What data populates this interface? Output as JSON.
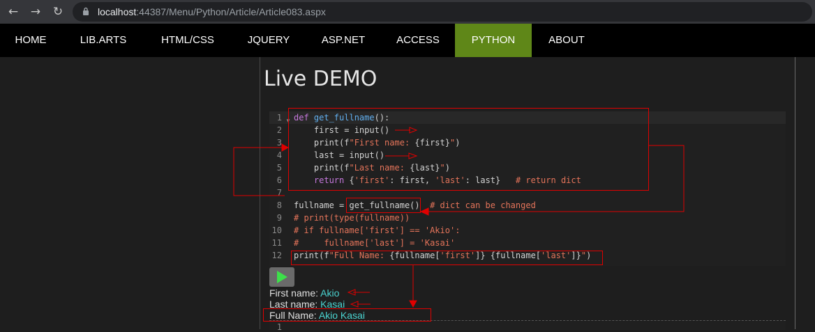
{
  "browser": {
    "url_host": "localhost",
    "url_rest": ":44387/Menu/Python/Article/Article083.aspx"
  },
  "nav": {
    "items": [
      {
        "label": "HOME",
        "active": false
      },
      {
        "label": "LIB.ARTS",
        "active": false
      },
      {
        "label": "HTML/CSS",
        "active": false
      },
      {
        "label": "JQUERY",
        "active": false
      },
      {
        "label": "ASP.NET",
        "active": false
      },
      {
        "label": "ACCESS",
        "active": false
      },
      {
        "label": "PYTHON",
        "active": true
      },
      {
        "label": "ABOUT",
        "active": false
      }
    ],
    "active_color": "#5f8718"
  },
  "page": {
    "title": "Live DEMO"
  },
  "editor": {
    "line_numbers": [
      "1",
      "2",
      "3",
      "4",
      "5",
      "6",
      "7",
      "8",
      "9",
      "10",
      "11",
      "12"
    ],
    "lines": [
      [
        {
          "t": "def ",
          "c": "kw"
        },
        {
          "t": "get_fullname",
          "c": "fn"
        },
        {
          "t": "():",
          "c": ""
        }
      ],
      [
        {
          "t": "    first = input()",
          "c": ""
        }
      ],
      [
        {
          "t": "    print(f",
          "c": ""
        },
        {
          "t": "\"First name: ",
          "c": "str"
        },
        {
          "t": "{first}",
          "c": ""
        },
        {
          "t": "\"",
          "c": "str"
        },
        {
          "t": ")",
          "c": ""
        }
      ],
      [
        {
          "t": "    last = input()",
          "c": ""
        }
      ],
      [
        {
          "t": "    print(f",
          "c": ""
        },
        {
          "t": "\"Last name: ",
          "c": "str"
        },
        {
          "t": "{last}",
          "c": ""
        },
        {
          "t": "\"",
          "c": "str"
        },
        {
          "t": ")",
          "c": ""
        }
      ],
      [
        {
          "t": "    ",
          "c": ""
        },
        {
          "t": "return",
          "c": "kw"
        },
        {
          "t": " {",
          "c": ""
        },
        {
          "t": "'first'",
          "c": "str"
        },
        {
          "t": ": first, ",
          "c": ""
        },
        {
          "t": "'last'",
          "c": "str"
        },
        {
          "t": ": last}   ",
          "c": ""
        },
        {
          "t": "# return dict",
          "c": "cm"
        }
      ],
      [],
      [
        {
          "t": "fullname = get_fullname()  ",
          "c": ""
        },
        {
          "t": "# dict can be changed",
          "c": "cm"
        }
      ],
      [
        {
          "t": "# print(type(fullname))",
          "c": "cm"
        }
      ],
      [
        {
          "t": "# if fullname['first'] == 'Akio':",
          "c": "cm"
        }
      ],
      [
        {
          "t": "#     fullname['last'] = 'Kasai'",
          "c": "cm"
        }
      ],
      [
        {
          "t": "print(f",
          "c": ""
        },
        {
          "t": "\"Full Name: ",
          "c": "str"
        },
        {
          "t": "{fullname[",
          "c": ""
        },
        {
          "t": "'first'",
          "c": "str"
        },
        {
          "t": "]} {fullname[",
          "c": ""
        },
        {
          "t": "'last'",
          "c": "str"
        },
        {
          "t": "]}",
          "c": ""
        },
        {
          "t": "\"",
          "c": "str"
        },
        {
          "t": ")",
          "c": ""
        }
      ]
    ]
  },
  "output": [
    {
      "label": "First name: ",
      "value": "Akio"
    },
    {
      "label": "Last name: ",
      "value": "Kasai"
    },
    {
      "label": "Full Name: ",
      "value": "Akio Kasai"
    }
  ],
  "next_editor_line": "1",
  "colors": {
    "annotation": "#e00000",
    "output_value": "#4ad3d0"
  }
}
